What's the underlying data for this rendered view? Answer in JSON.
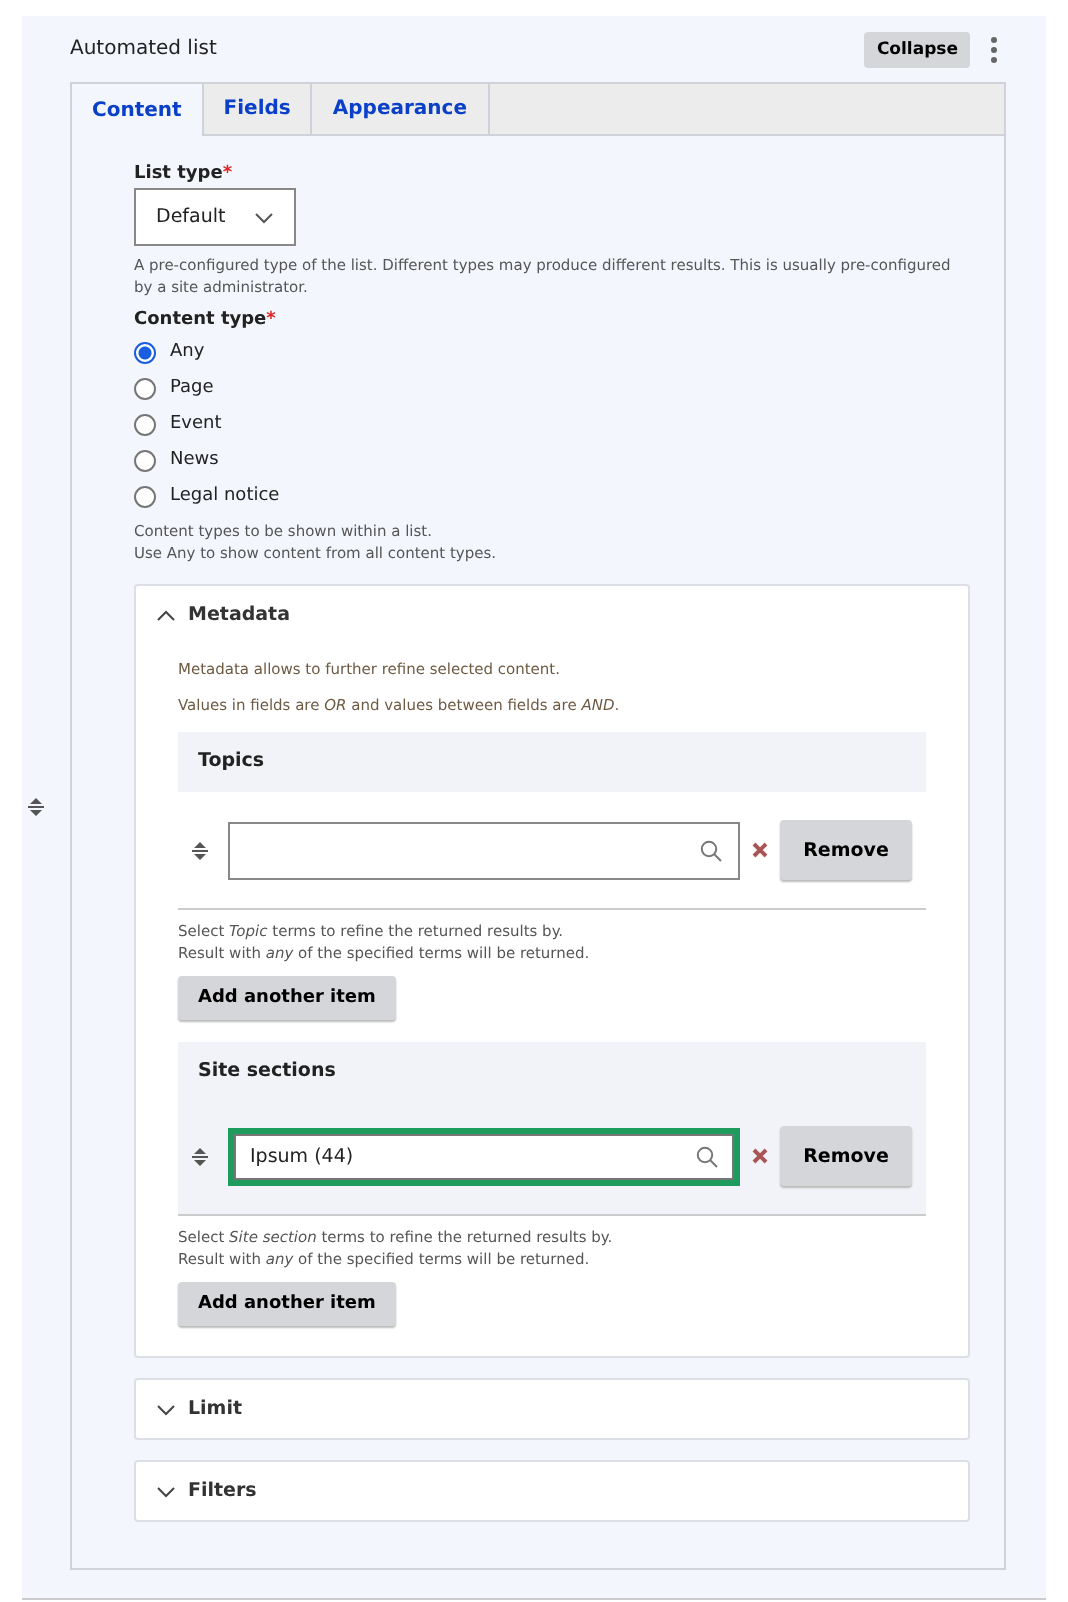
{
  "widget": {
    "title": "Automated list",
    "collapse_button": "Collapse"
  },
  "tabs": [
    {
      "label": "Content",
      "selected": true
    },
    {
      "label": "Fields",
      "selected": false
    },
    {
      "label": "Appearance",
      "selected": false
    }
  ],
  "list_type": {
    "label": "List type",
    "required_mark": "*",
    "value": "Default",
    "help": "A pre-configured type of the list. Different types may produce different results. This is usually pre-configured by a site administrator."
  },
  "content_type": {
    "label": "Content type",
    "required_mark": "*",
    "options": [
      {
        "label": "Any",
        "selected": true
      },
      {
        "label": "Page",
        "selected": false
      },
      {
        "label": "Event",
        "selected": false
      },
      {
        "label": "News",
        "selected": false
      },
      {
        "label": "Legal notice",
        "selected": false
      }
    ],
    "help": [
      "Content types to be shown within a list.",
      "Use Any to show content from all content types."
    ]
  },
  "sections": [
    {
      "title": "Metadata",
      "expanded": true,
      "intro": [
        "Metadata allows to further refine selected content.",
        "Values in fields are *OR* and values between fields are *AND*."
      ],
      "fields": [
        {
          "title": "Topics",
          "focused": false,
          "remove_button": "Remove",
          "help": [
            "Select *Topic* terms to refine the returned results by.",
            "Result with *any* of the specified terms will be returned."
          ],
          "add_button": "Add another item"
        },
        {
          "title": "Site sections",
          "value": "Ipsum (44)",
          "focused": true,
          "remove_button": "Remove",
          "help": [
            "Select *Site section* terms to refine the returned results by.",
            "Result with *any* of the specified terms will be returned."
          ],
          "add_button": "Add another item"
        }
      ]
    },
    {
      "title": "Limit",
      "expanded": false
    },
    {
      "title": "Filters",
      "expanded": false
    }
  ]
}
